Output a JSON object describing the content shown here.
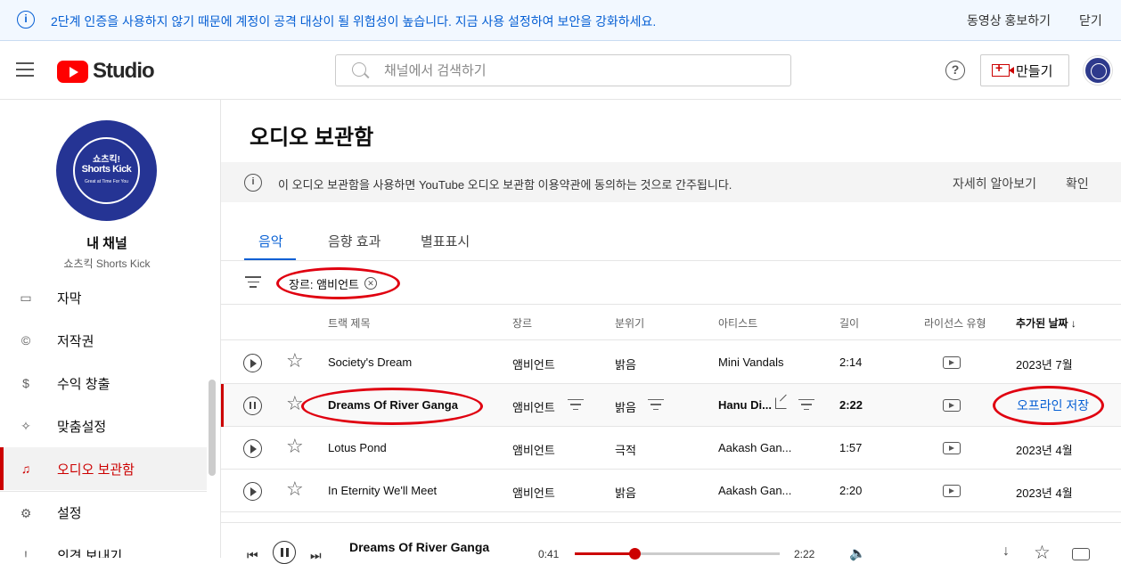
{
  "banner": {
    "message": "2단계 인증을 사용하지 않기 때문에 계정이 공격 대상이 될 위험성이 높습니다. 지금 사용 설정하여 보안을 강화하세요.",
    "promote": "동영상 홍보하기",
    "close": "닫기"
  },
  "header": {
    "logo_text": "Studio",
    "search_placeholder": "채널에서 검색하기",
    "create_label": "만들기"
  },
  "channel": {
    "avatar_line1": "쇼츠킥!",
    "avatar_line2": "Shorts Kick",
    "avatar_line3": "Great at Time For You",
    "name": "내 채널",
    "handle": "쇼츠킥 Shorts Kick"
  },
  "sidebar": {
    "items": [
      {
        "label": "자막",
        "icon": "subtitles-icon"
      },
      {
        "label": "저작권",
        "icon": "copyright-icon"
      },
      {
        "label": "수익 창출",
        "icon": "dollar-icon"
      },
      {
        "label": "맞춤설정",
        "icon": "magic-wand-icon"
      },
      {
        "label": "오디오 보관함",
        "icon": "audio-library-icon"
      },
      {
        "label": "설정",
        "icon": "gear-icon"
      },
      {
        "label": "의견 보내기",
        "icon": "feedback-icon"
      }
    ]
  },
  "page": {
    "title": "오디오 보관함",
    "notice": "이 오디오 보관함을 사용하면 YouTube 오디오 보관함 이용약관에 동의하는 것으로 간주됩니다.",
    "learn_more": "자세히 알아보기",
    "confirm": "확인",
    "tabs": [
      "음악",
      "음향 효과",
      "별표표시"
    ],
    "filter_chip": "장르: 앰비언트"
  },
  "table": {
    "headers": {
      "track": "트랙 제목",
      "genre": "장르",
      "mood": "분위기",
      "artist": "아티스트",
      "length": "길이",
      "license": "라이선스 유형",
      "added": "추가된 날짜"
    },
    "rows": [
      {
        "title": "Society's Dream",
        "genre": "앰비언트",
        "mood": "밝음",
        "artist": "Mini Vandals",
        "length": "2:14",
        "added": "2023년 7월"
      },
      {
        "title": "Dreams Of River Ganga",
        "genre": "앰비언트",
        "mood": "밝음",
        "artist": "Hanu Di...",
        "length": "2:22",
        "added": "오프라인 저장"
      },
      {
        "title": "Lotus Pond",
        "genre": "앰비언트",
        "mood": "극적",
        "artist": "Aakash Gan...",
        "length": "1:57",
        "added": "2023년 4월"
      },
      {
        "title": "In Eternity We'll Meet",
        "genre": "앰비언트",
        "mood": "밝음",
        "artist": "Aakash Gan...",
        "length": "2:20",
        "added": "2023년 4월"
      }
    ]
  },
  "player": {
    "title": "Dreams Of River Ganga",
    "current": "0:41",
    "duration": "2:22",
    "progress": 0.29
  },
  "colors": {
    "accent": "#065fd4",
    "brand_red": "#cc0000",
    "annotation_red": "#e00010"
  }
}
